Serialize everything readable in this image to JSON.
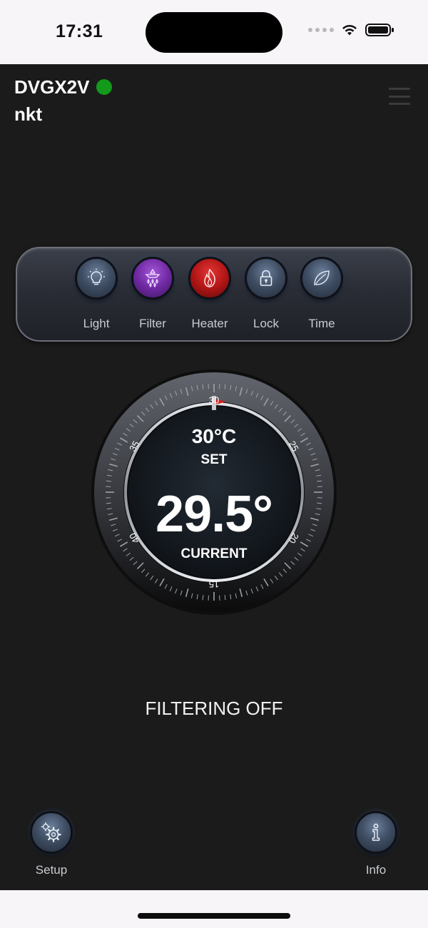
{
  "status_bar": {
    "time": "17:31"
  },
  "header": {
    "device_name": "DVGX2V",
    "user_name": "nkt",
    "online_color": "#139a1a"
  },
  "controls": [
    {
      "label": "Light",
      "icon": "bulb-icon",
      "state": "off"
    },
    {
      "label": "Filter",
      "icon": "filter-icon",
      "state": "on",
      "color": "#7b2fb5"
    },
    {
      "label": "Heater",
      "icon": "flame-icon",
      "state": "on",
      "color": "#c21b1b"
    },
    {
      "label": "Lock",
      "icon": "lock-icon",
      "state": "off"
    },
    {
      "label": "Time",
      "icon": "leaf-icon",
      "state": "off"
    }
  ],
  "thermostat": {
    "scale_labels": [
      "15",
      "20",
      "25",
      "30",
      "35",
      "40"
    ],
    "set_value": "30°C",
    "set_label": "SET",
    "current_value": "29.5°",
    "current_label": "CURRENT"
  },
  "status": {
    "filtering": "FILTERING OFF"
  },
  "bottom_nav": {
    "setup_label": "Setup",
    "info_label": "Info"
  }
}
